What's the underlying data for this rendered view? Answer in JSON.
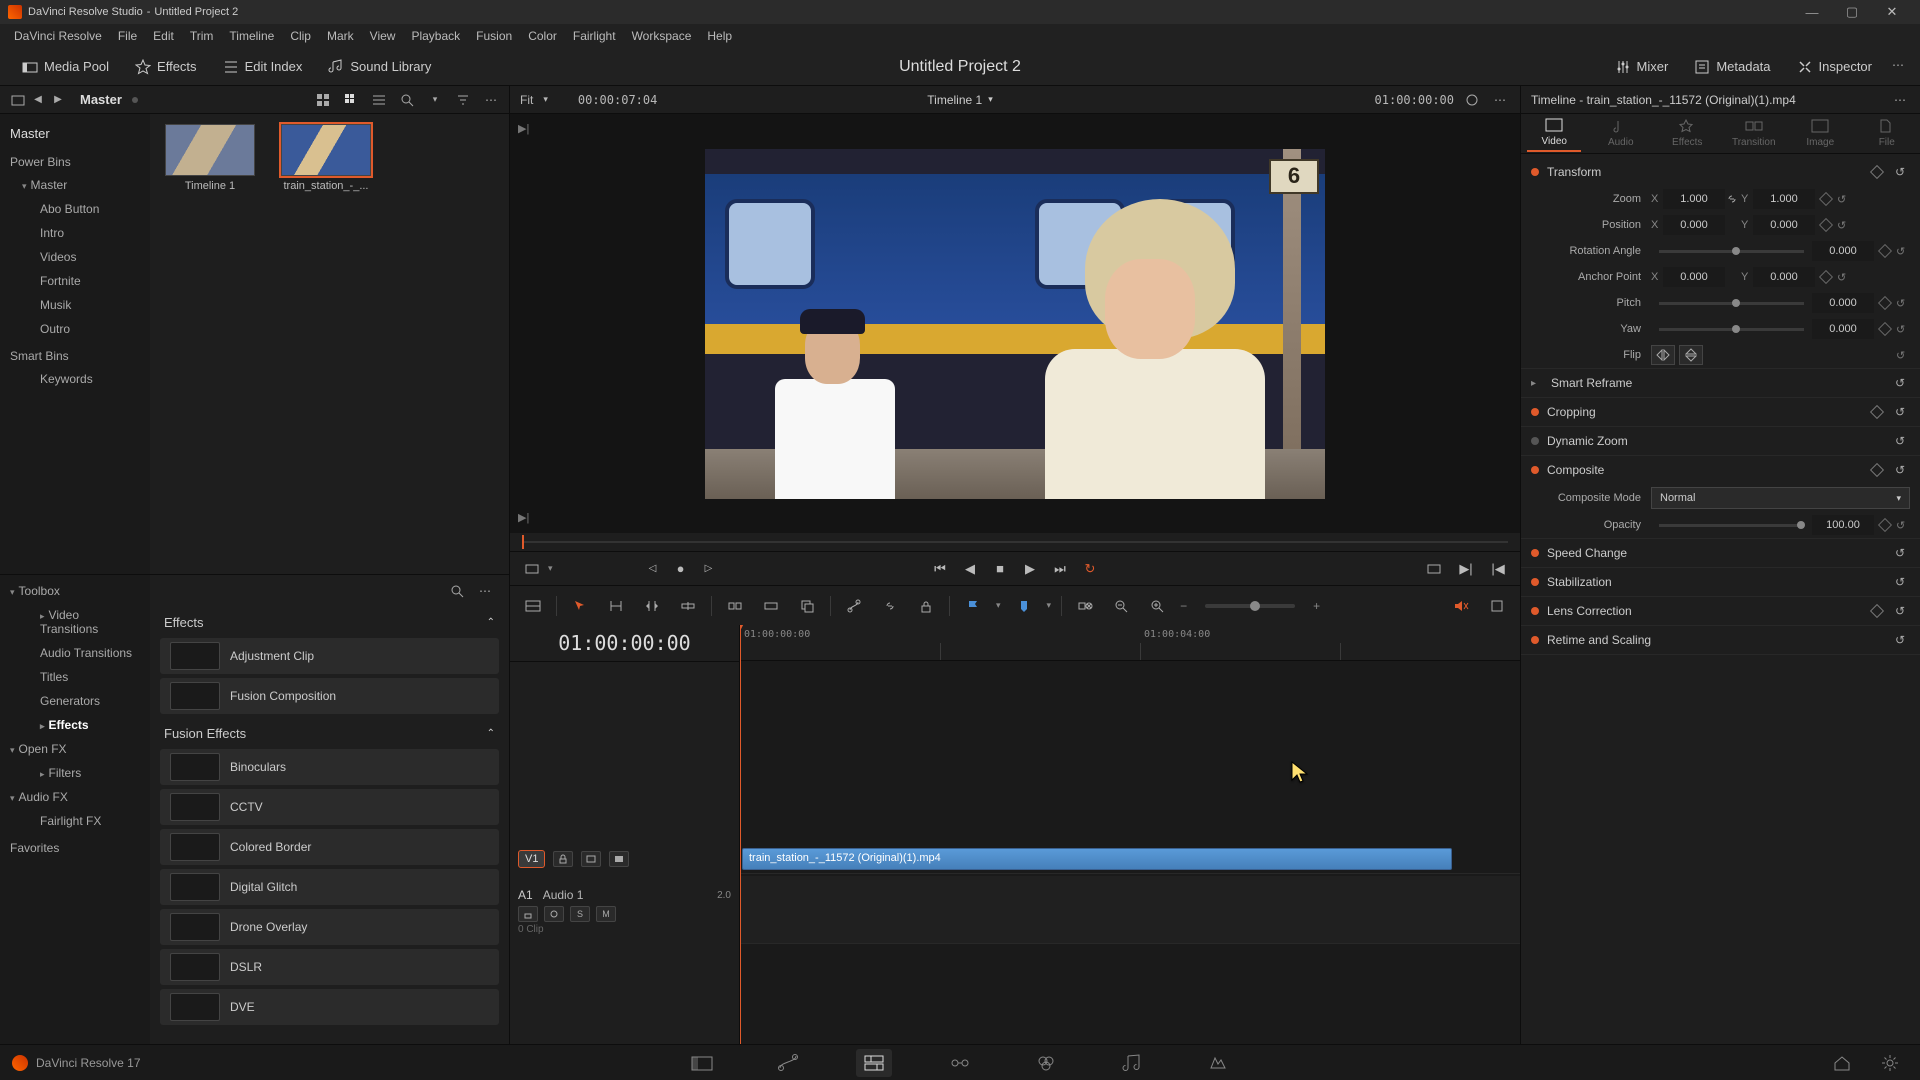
{
  "titlebar": {
    "app_name": "DaVinci Resolve Studio",
    "document": "Untitled Project 2"
  },
  "window_controls": {
    "min": "—",
    "max": "▢",
    "close": "✕"
  },
  "menu": [
    "DaVinci Resolve",
    "File",
    "Edit",
    "Trim",
    "Timeline",
    "Clip",
    "Mark",
    "View",
    "Playback",
    "Fusion",
    "Color",
    "Fairlight",
    "Workspace",
    "Help"
  ],
  "workspace": {
    "media_pool": "Media Pool",
    "effects": "Effects",
    "edit_index": "Edit Index",
    "sound_library": "Sound Library",
    "project_title": "Untitled Project 2",
    "mixer": "Mixer",
    "metadata": "Metadata",
    "inspector": "Inspector"
  },
  "media_pool": {
    "breadcrumb": "Master",
    "thumbs": [
      {
        "label": "Timeline 1"
      },
      {
        "label": "train_station_-_..."
      }
    ],
    "tree": {
      "master": "Master",
      "power_bins": "Power Bins",
      "power_items": [
        "Master",
        "Abo Button",
        "Intro",
        "Videos",
        "Fortnite",
        "Musik",
        "Outro"
      ],
      "smart_bins": "Smart Bins",
      "smart_items": [
        "Keywords"
      ]
    }
  },
  "viewer": {
    "fit": "Fit",
    "duration": "00:00:07:04",
    "timeline_name": "Timeline 1",
    "timecode": "01:00:00:00"
  },
  "timeline": {
    "playhead_tc": "01:00:00:00",
    "ruler_labels": [
      "01:00:00:00",
      "01:00:04:00"
    ],
    "clip_name": "train_station_-_11572 (Original)(1).mp4",
    "v1": "V1",
    "a1": "A1",
    "a1_name": "Audio 1",
    "a1_level": "2.0",
    "a1_clips": "0 Clip"
  },
  "effects_panel": {
    "toolbox": "Toolbox",
    "categories": [
      "Video Transitions",
      "Audio Transitions",
      "Titles",
      "Generators"
    ],
    "effects_sel": "Effects",
    "openfx": "Open FX",
    "filters": "Filters",
    "audiofx": "Audio FX",
    "fairlightfx": "Fairlight FX",
    "favorites": "Favorites",
    "group_effects": "Effects",
    "group_fusion": "Fusion Effects",
    "list_effects": [
      "Adjustment Clip",
      "Fusion Composition"
    ],
    "list_fusion": [
      "Binoculars",
      "CCTV",
      "Colored Border",
      "Digital Glitch",
      "Drone Overlay",
      "DSLR",
      "DVE"
    ]
  },
  "inspector": {
    "header": "Timeline - train_station_-_11572 (Original)(1).mp4",
    "tabs": [
      "Video",
      "Audio",
      "Effects",
      "Transition",
      "Image",
      "File"
    ],
    "transform": {
      "title": "Transform",
      "zoom": "Zoom",
      "zoom_x": "1.000",
      "zoom_y": "1.000",
      "position": "Position",
      "pos_x": "0.000",
      "pos_y": "0.000",
      "rotation": "Rotation Angle",
      "rot_val": "0.000",
      "anchor": "Anchor Point",
      "anc_x": "0.000",
      "anc_y": "0.000",
      "pitch": "Pitch",
      "pitch_val": "0.000",
      "yaw": "Yaw",
      "yaw_val": "0.000",
      "flip": "Flip"
    },
    "smart_reframe": "Smart Reframe",
    "cropping": "Cropping",
    "dynamic_zoom": "Dynamic Zoom",
    "composite": "Composite",
    "composite_mode_label": "Composite Mode",
    "composite_mode": "Normal",
    "opacity_label": "Opacity",
    "opacity": "100.00",
    "speed_change": "Speed Change",
    "stabilization": "Stabilization",
    "lens_correction": "Lens Correction",
    "retime": "Retime and Scaling"
  },
  "status": {
    "version": "DaVinci Resolve 17"
  },
  "axis": {
    "x": "X",
    "y": "Y"
  }
}
